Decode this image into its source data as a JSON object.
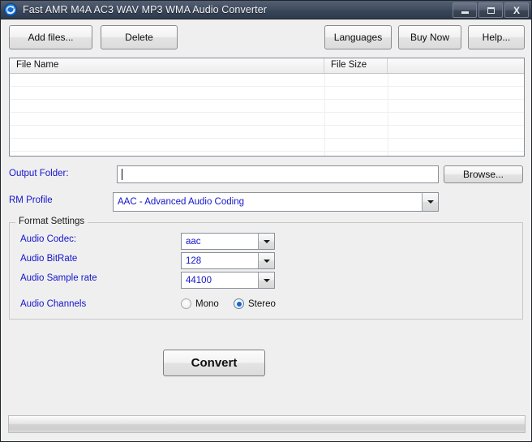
{
  "window": {
    "title": "Fast AMR M4A AC3 WAV MP3 WMA Audio Converter",
    "app_icon": "convert-arrows-icon",
    "caption": {
      "minimize": "minimize-icon",
      "maximize": "maximize-icon",
      "close": "X"
    },
    "colors": {
      "titlebar": "#39455a",
      "face": "#efefef",
      "label_blue": "#1414cc",
      "radio_accent": "#1568c8"
    }
  },
  "toolbar": {
    "add_files_label": "Add files...",
    "delete_label": "Delete",
    "languages_label": "Languages",
    "buy_now_label": "Buy Now",
    "help_label": "Help..."
  },
  "file_list": {
    "columns": [
      "File Name",
      "File Size",
      ""
    ],
    "rows": [],
    "empty_row_count": 6
  },
  "output": {
    "folder_label": "Output Folder:",
    "folder_value": "",
    "folder_placeholder": "",
    "browse_label": "Browse..."
  },
  "profile": {
    "label": "RM Profile",
    "value": "AAC - Advanced Audio Coding"
  },
  "format_settings": {
    "group_title": "Format Settings",
    "codec_label": "Audio Codec:",
    "codec_value": "aac",
    "bitrate_label": "Audio BitRate",
    "bitrate_value": "128",
    "samplerate_label": "Audio Sample rate",
    "samplerate_value": "44100",
    "channels_label": "Audio Channels",
    "mono_label": "Mono",
    "stereo_label": "Stereo",
    "channels_selected": "Stereo"
  },
  "actions": {
    "convert_label": "Convert"
  },
  "progress": {
    "value": 0,
    "text": ""
  }
}
